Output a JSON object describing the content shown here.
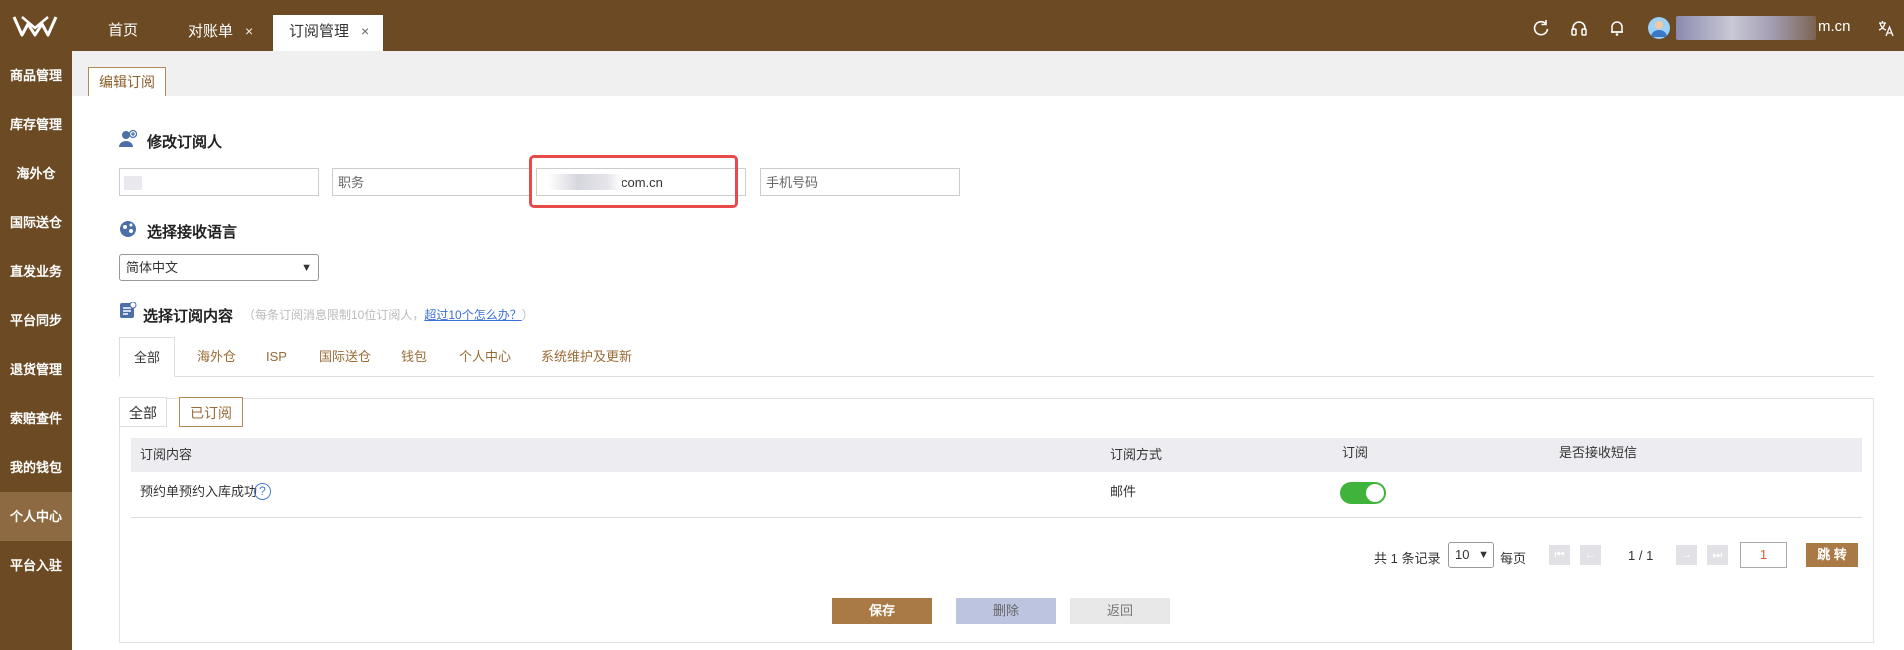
{
  "topbar": {
    "tabs": [
      {
        "label": "首页"
      },
      {
        "label": "对账单",
        "close": "×"
      },
      {
        "label": "订阅管理",
        "close": "×"
      }
    ],
    "user_email": "m.cn",
    "icons": [
      "refresh-icon",
      "headset-icon",
      "bell-icon",
      "avatar",
      "translate-icon"
    ]
  },
  "sidebar": {
    "items": [
      {
        "label": "商品管理"
      },
      {
        "label": "库存管理"
      },
      {
        "label": "海外仓"
      },
      {
        "label": "国际送仓"
      },
      {
        "label": "直发业务"
      },
      {
        "label": "平台同步"
      },
      {
        "label": "退货管理"
      },
      {
        "label": "索赔查件"
      },
      {
        "label": "我的钱包"
      },
      {
        "label": "个人中心",
        "active": true
      },
      {
        "label": "平台入驻"
      }
    ]
  },
  "page": {
    "sub_tab": "编辑订阅",
    "section_subscriber": "修改订阅人",
    "fields": {
      "name_value": "",
      "position_placeholder": "职务",
      "email_value": "com.cn",
      "phone_placeholder": "手机号码"
    },
    "section_language": "选择接收语言",
    "language_selected": "简体中文",
    "section_content": "选择订阅内容",
    "hint_prefix": "（每条订阅消息限制10位订阅人，",
    "hint_link": "超过10个怎么办？",
    "hint_suffix": "）",
    "category_tabs": [
      "全部",
      "海外仓",
      "ISP",
      "国际送仓",
      "钱包",
      "个人中心",
      "系统维护及更新"
    ],
    "filter_tabs": [
      "全部",
      "已订阅"
    ],
    "table": {
      "headers": [
        "订阅内容",
        "订阅方式",
        "订阅",
        "是否接收短信"
      ],
      "rows": [
        {
          "content": "预约单预约入库成功",
          "method": "邮件",
          "subscribed": true,
          "sms": ""
        }
      ]
    },
    "pagination": {
      "total_text": "共 1 条记录",
      "page_size": "10",
      "per_page": "每页",
      "page_info": "1 / 1",
      "page_input": "1",
      "jump_label": "跳 转"
    },
    "buttons": {
      "save": "保存",
      "delete": "删除",
      "back": "返回"
    },
    "colors": {
      "brand": "#6c4a24",
      "accent": "#a97a45",
      "toggle_on": "#3fb33a",
      "highlight": "#e84a4a"
    }
  }
}
